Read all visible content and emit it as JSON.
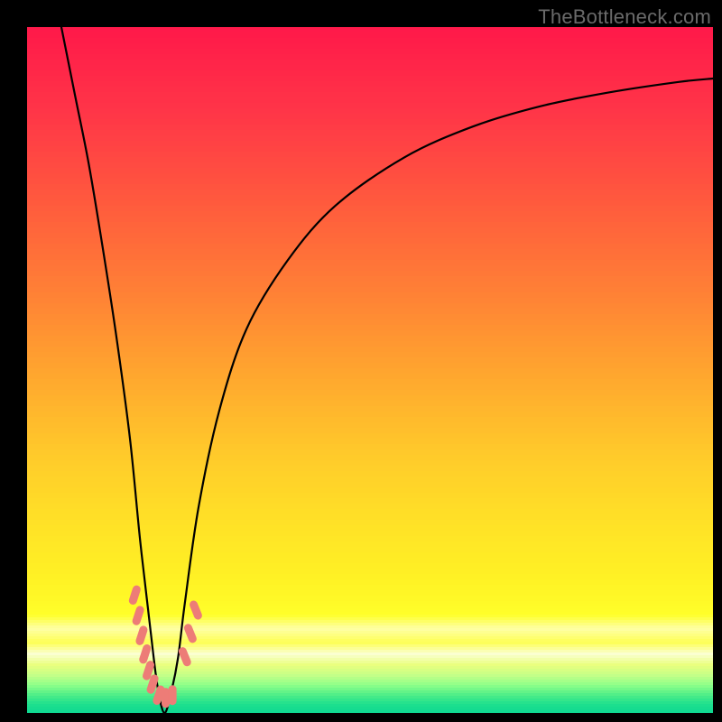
{
  "watermark": "TheBottleneck.com",
  "chart_data": {
    "type": "line",
    "title": "",
    "xlabel": "",
    "ylabel": "",
    "xlim": [
      0,
      100
    ],
    "ylim": [
      0,
      100
    ],
    "grid": false,
    "legend": false,
    "series": [
      {
        "name": "bottleneck-curve",
        "color": "#000000",
        "x": [
          5,
          7,
          9,
          11,
          13,
          15,
          16.5,
          18,
          19,
          20,
          21,
          22,
          23,
          25,
          28,
          32,
          38,
          45,
          55,
          65,
          75,
          85,
          95,
          100
        ],
        "y": [
          100,
          90,
          80,
          68,
          55,
          40,
          25,
          12,
          4,
          0,
          3,
          8,
          16,
          30,
          44,
          56,
          66,
          74,
          81,
          85.5,
          88.5,
          90.5,
          92,
          92.5
        ]
      }
    ],
    "markers": [
      {
        "name": "left-dash-cluster",
        "color": "#ed7c77",
        "shape": "short-dash",
        "points": [
          {
            "x": 15.7,
            "y": 17.2
          },
          {
            "x": 16.2,
            "y": 14.2
          },
          {
            "x": 16.7,
            "y": 11.3
          },
          {
            "x": 17.2,
            "y": 8.6
          },
          {
            "x": 17.7,
            "y": 6.2
          },
          {
            "x": 18.3,
            "y": 4.2
          },
          {
            "x": 19.2,
            "y": 2.6
          },
          {
            "x": 20.2,
            "y": 2.2
          },
          {
            "x": 21.2,
            "y": 2.6
          }
        ]
      },
      {
        "name": "right-dash-cluster",
        "color": "#ed7c77",
        "shape": "short-dash",
        "points": [
          {
            "x": 23.0,
            "y": 8.2
          },
          {
            "x": 23.8,
            "y": 11.6
          },
          {
            "x": 24.6,
            "y": 15.0
          }
        ]
      }
    ],
    "background_gradient": {
      "orientation": "vertical",
      "stops": [
        {
          "pos": 0.0,
          "color": "#ff1a4a"
        },
        {
          "pos": 0.12,
          "color": "#ff3648"
        },
        {
          "pos": 0.25,
          "color": "#ff5a3e"
        },
        {
          "pos": 0.38,
          "color": "#ff8036"
        },
        {
          "pos": 0.5,
          "color": "#ffa62f"
        },
        {
          "pos": 0.62,
          "color": "#ffcb2b"
        },
        {
          "pos": 0.72,
          "color": "#ffe227"
        },
        {
          "pos": 0.8,
          "color": "#fff225"
        },
        {
          "pos": 0.855,
          "color": "#ffff2a"
        },
        {
          "pos": 0.875,
          "color": "#feffa8"
        },
        {
          "pos": 0.895,
          "color": "#feff54"
        },
        {
          "pos": 0.912,
          "color": "#fbffd3"
        },
        {
          "pos": 0.928,
          "color": "#eaff7e"
        },
        {
          "pos": 0.943,
          "color": "#c5ff88"
        },
        {
          "pos": 0.958,
          "color": "#8cff8a"
        },
        {
          "pos": 0.972,
          "color": "#4eee88"
        },
        {
          "pos": 0.985,
          "color": "#1fe08e"
        },
        {
          "pos": 1.0,
          "color": "#0cd893"
        }
      ]
    }
  }
}
